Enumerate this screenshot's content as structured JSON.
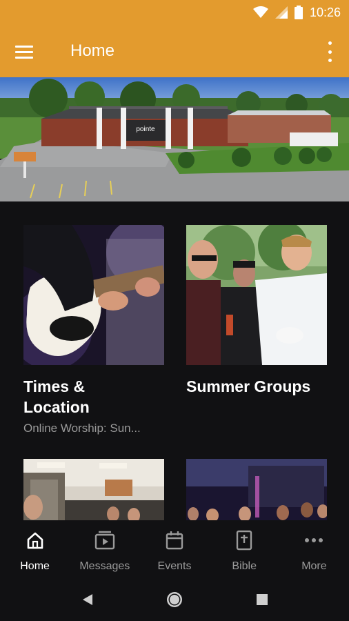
{
  "status_bar": {
    "time": "10:26"
  },
  "app_bar": {
    "title": "Home"
  },
  "hero": {
    "sign_text": "pointe"
  },
  "cards": [
    {
      "title_line1": "Times &",
      "title_line2": "Location",
      "subtitle": "Online Worship: Sun..."
    },
    {
      "title_line1": "Summer Groups",
      "title_line2": "",
      "subtitle": ""
    }
  ],
  "bottom_nav": {
    "items": [
      {
        "label": "Home",
        "icon": "home-icon",
        "active": true
      },
      {
        "label": "Messages",
        "icon": "video-icon",
        "active": false
      },
      {
        "label": "Events",
        "icon": "calendar-icon",
        "active": false
      },
      {
        "label": "Bible",
        "icon": "bible-icon",
        "active": false
      },
      {
        "label": "More",
        "icon": "more-horizontal-icon",
        "active": false
      }
    ]
  },
  "colors": {
    "accent": "#E39B2E",
    "background": "#111113",
    "text_secondary": "#9a9a9a"
  }
}
